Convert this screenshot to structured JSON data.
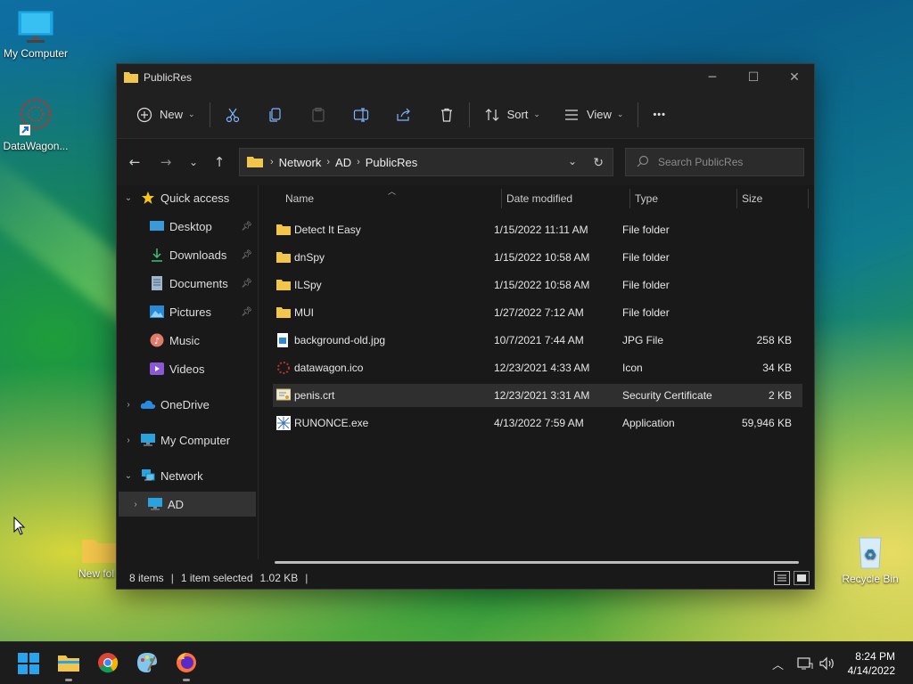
{
  "desktop": {
    "icons": [
      {
        "label": "My Computer"
      },
      {
        "label": "DataWagon..."
      },
      {
        "label": "New fol"
      },
      {
        "label": "Recycle Bin"
      }
    ]
  },
  "window": {
    "title": "PublicRes",
    "controls": {
      "minimize": "─",
      "maximize": "☐",
      "close": "✕"
    }
  },
  "toolbar": {
    "new_label": "New",
    "sort_label": "Sort",
    "view_label": "View",
    "more_label": "•••"
  },
  "address": {
    "crumbs": [
      "Network",
      "AD",
      "PublicRes"
    ],
    "search_placeholder": "Search PublicRes"
  },
  "sidebar": {
    "items": [
      {
        "label": "Quick access"
      },
      {
        "label": "Desktop"
      },
      {
        "label": "Downloads"
      },
      {
        "label": "Documents"
      },
      {
        "label": "Pictures"
      },
      {
        "label": "Music"
      },
      {
        "label": "Videos"
      },
      {
        "label": "OneDrive"
      },
      {
        "label": "My Computer"
      },
      {
        "label": "Network"
      },
      {
        "label": "AD"
      }
    ]
  },
  "columns": {
    "name": "Name",
    "date": "Date modified",
    "type": "Type",
    "size": "Size"
  },
  "files": [
    {
      "name": "Detect It Easy",
      "date": "1/15/2022 11:11 AM",
      "type": "File folder",
      "size": "",
      "icon": "folder-icon"
    },
    {
      "name": "dnSpy",
      "date": "1/15/2022 10:58 AM",
      "type": "File folder",
      "size": "",
      "icon": "folder-icon"
    },
    {
      "name": "ILSpy",
      "date": "1/15/2022 10:58 AM",
      "type": "File folder",
      "size": "",
      "icon": "folder-icon"
    },
    {
      "name": "MUI",
      "date": "1/27/2022 7:12 AM",
      "type": "File folder",
      "size": "",
      "icon": "folder-icon"
    },
    {
      "name": "background-old.jpg",
      "date": "10/7/2021 7:44 AM",
      "type": "JPG File",
      "size": "258 KB",
      "icon": "image-file-icon"
    },
    {
      "name": "datawagon.ico",
      "date": "12/23/2021 4:33 AM",
      "type": "Icon",
      "size": "34 KB",
      "icon": "ico-file-icon"
    },
    {
      "name": "penis.crt",
      "date": "12/23/2021 3:31 AM",
      "type": "Security Certificate",
      "size": "2 KB",
      "icon": "certificate-icon"
    },
    {
      "name": "RUNONCE.exe",
      "date": "4/13/2022 7:59 AM",
      "type": "Application",
      "size": "59,946 KB",
      "icon": "exe-file-icon"
    }
  ],
  "status": {
    "count": "8 items",
    "selected": "1 item selected",
    "size": "1.02 KB",
    "divider": "|"
  },
  "clock": {
    "time": "8:24 PM",
    "date": "4/14/2022"
  },
  "colors": {
    "accent": "#0078d4",
    "folder": "#f2c54b"
  }
}
